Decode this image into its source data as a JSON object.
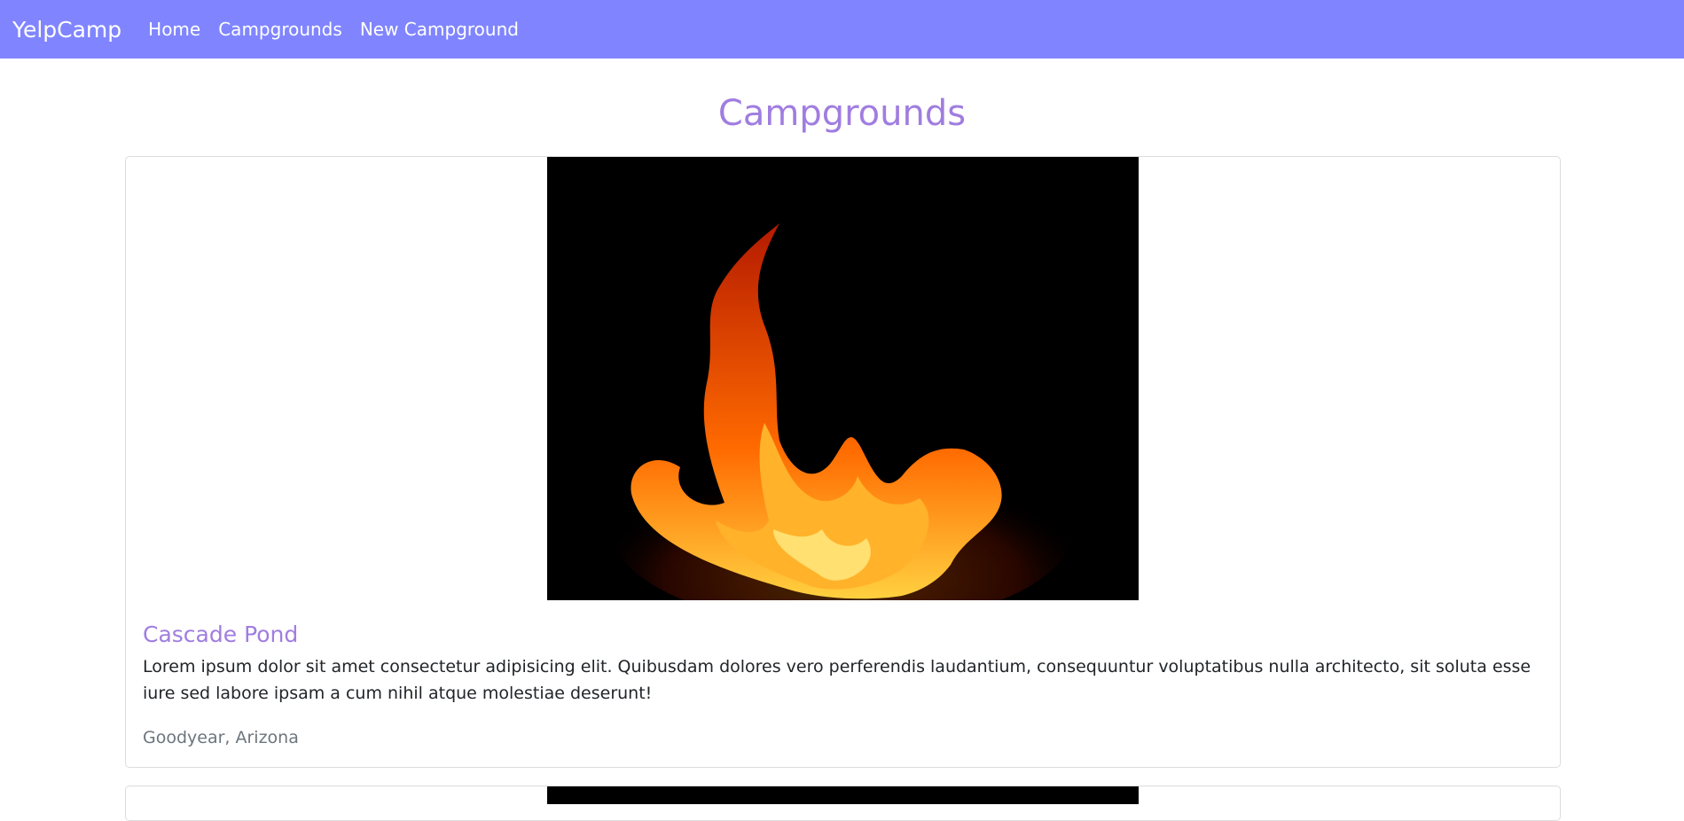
{
  "navbar": {
    "brand": "YelpCamp",
    "links": [
      "Home",
      "Campgrounds",
      "New Campground"
    ],
    "background": "#8085ff"
  },
  "page": {
    "title": "Campgrounds"
  },
  "campgrounds": [
    {
      "title": "Cascade Pond",
      "description": "Lorem ipsum dolor sit amet consectetur adipisicing elit. Quibusdam dolores vero perferendis laudantium, consequuntur voluptatibus nulla architecto, sit soluta esse iure sed labore ipsam a cum nihil atque molestiae deserunt!",
      "location": "Goodyear, Arizona"
    }
  ],
  "colors": {
    "accent": "#a07de0",
    "text": "#212529",
    "muted": "#6c757d"
  }
}
